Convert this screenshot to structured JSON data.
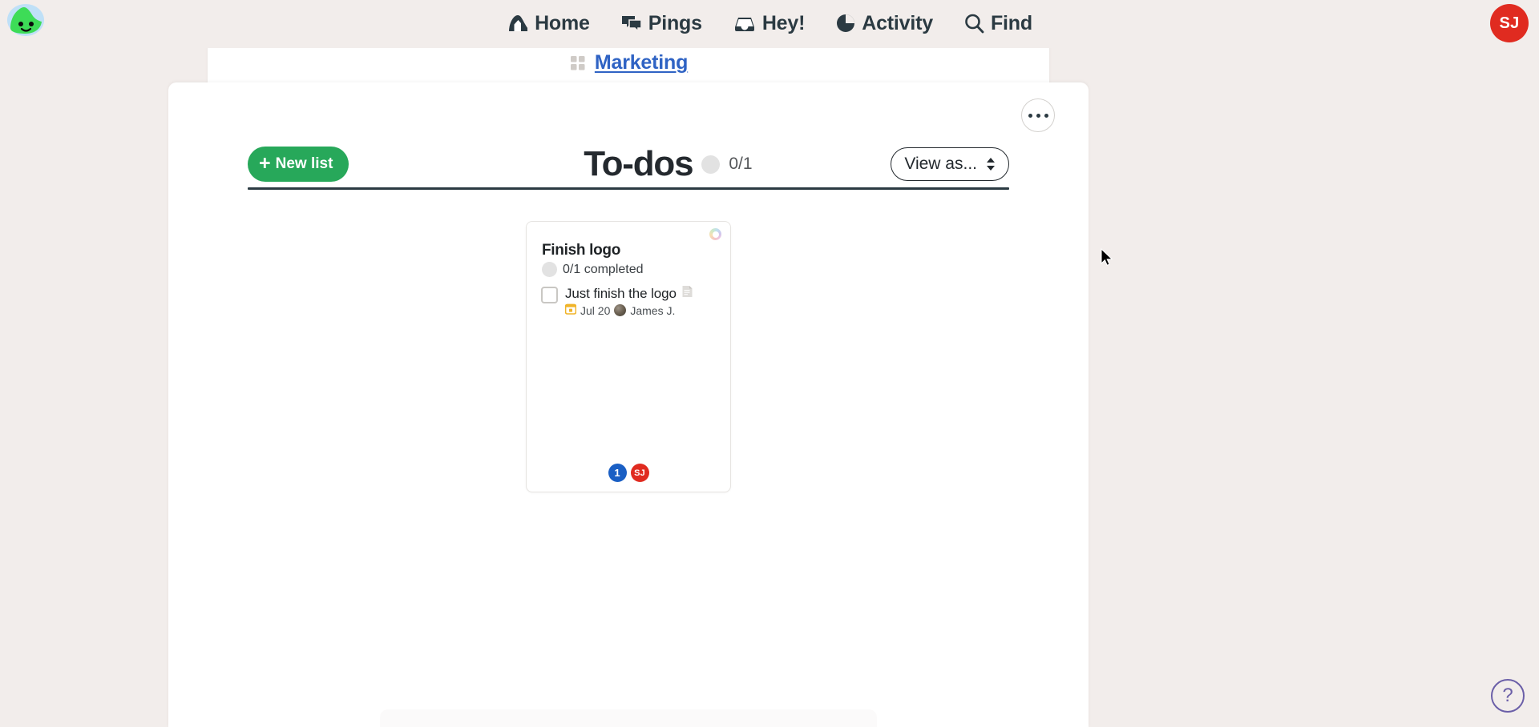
{
  "app": {
    "logo_icon": "basecamp-logo-icon",
    "background_color": "#f2edeb"
  },
  "topnav": {
    "items": [
      {
        "label": "Home",
        "icon": "home-icon"
      },
      {
        "label": "Pings",
        "icon": "chat-bubbles-icon"
      },
      {
        "label": "Hey!",
        "icon": "inbox-tray-icon"
      },
      {
        "label": "Activity",
        "icon": "pie-clock-icon"
      },
      {
        "label": "Find",
        "icon": "magnifier-icon"
      }
    ],
    "account_avatar": {
      "initials": "SJ",
      "color": "#e02b20"
    }
  },
  "project": {
    "name": "Marketing",
    "icon": "grid-squares-icon",
    "link_color": "#2f63c4"
  },
  "toolbar": {
    "more_label": "•••",
    "new_list_label": "New list",
    "new_list_plus": "+",
    "new_list_color": "#27a85a",
    "view_as_label": "View as...",
    "stepper_icon": "up-down-chevrons-icon"
  },
  "header": {
    "title": "To-dos",
    "progress_count": "0/1",
    "progress_ring_color": "#e2e2e2"
  },
  "list_card": {
    "status_icon": "rainbow-ring-icon",
    "title": "Finish logo",
    "completed_text": "0/1 completed",
    "todos": [
      {
        "text": "Just finish the logo",
        "notes_icon": "document-lines-icon",
        "due_icon": "calendar-icon",
        "due_date": "Jul 20",
        "assignee_avatar": "person-photo-avatar",
        "assignee": "James J.",
        "checked": false
      }
    ],
    "footer": {
      "comment_count": "1",
      "comment_badge_color": "#1a5fc4",
      "member_initials": "SJ",
      "member_color": "#e02b20"
    }
  },
  "help": {
    "label": "?",
    "color": "#6b5fa8"
  }
}
